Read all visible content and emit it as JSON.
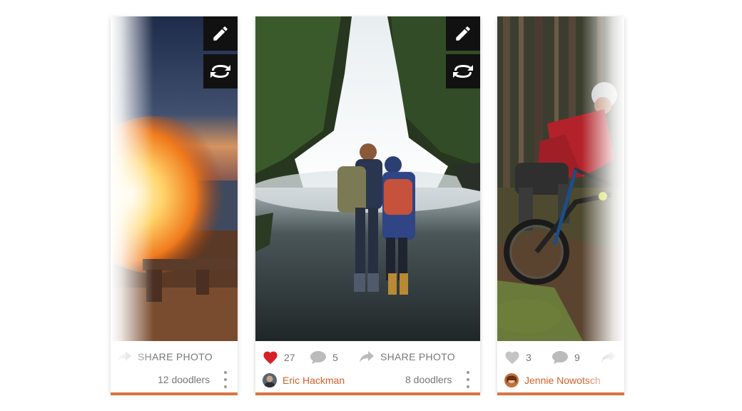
{
  "cards": [
    {
      "share_label": "SHARE PHOTO",
      "doodlers": "12 doodlers",
      "photo_icon": "campfire-photo"
    },
    {
      "likes": "27",
      "comments": "5",
      "share_label": "SHARE PHOTO",
      "doodlers": "8 doodlers",
      "user_name": "Eric Hackman",
      "photo_icon": "waterfall-hikers-photo"
    },
    {
      "likes": "3",
      "comments": "9",
      "user_name": "Jennie Nowotsch",
      "photo_icon": "mountain-biker-photo"
    }
  ],
  "colors": {
    "accent": "#d65f25",
    "like_active": "#d61f26",
    "muted": "#777777",
    "tool_bg": "#111111"
  },
  "icons": [
    "pencil-icon",
    "rotate-icon",
    "heart-icon",
    "comment-icon",
    "share-arrow-icon",
    "more-vertical-icon"
  ]
}
